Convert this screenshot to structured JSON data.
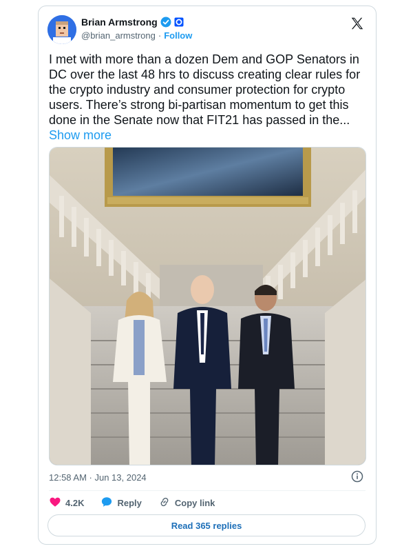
{
  "author": {
    "name": "Brian Armstrong",
    "handle": "@brian_armstrong",
    "separator": "·",
    "follow_label": "Follow"
  },
  "tweet": {
    "text": "I met with more than a dozen Dem and GOP Senators in DC over the last 48 hrs to discuss creating clear rules for the crypto industry and consumer protection for crypto users. There’s strong bi-partisan momentum to get this done in the Senate now that FIT21 has passed in the...",
    "show_more_label": "Show more",
    "timestamp": "12:58 AM · Jun 13, 2024",
    "photo_alt": "Three people standing on a marble staircase beneath a painting"
  },
  "actions": {
    "likes": "4.2K",
    "reply_label": "Reply",
    "copy_link_label": "Copy link"
  },
  "read_replies_label": "Read 365 replies",
  "icons": {
    "verified": "verified-badge-icon",
    "org": "affiliate-badge-icon",
    "x_logo": "x-logo-icon",
    "info": "info-icon",
    "heart": "heart-icon",
    "reply": "reply-bubble-icon",
    "link": "link-icon"
  },
  "colors": {
    "accent": "#1d9bf0",
    "like": "#f91880",
    "text": "#0f1419",
    "muted": "#536471"
  }
}
